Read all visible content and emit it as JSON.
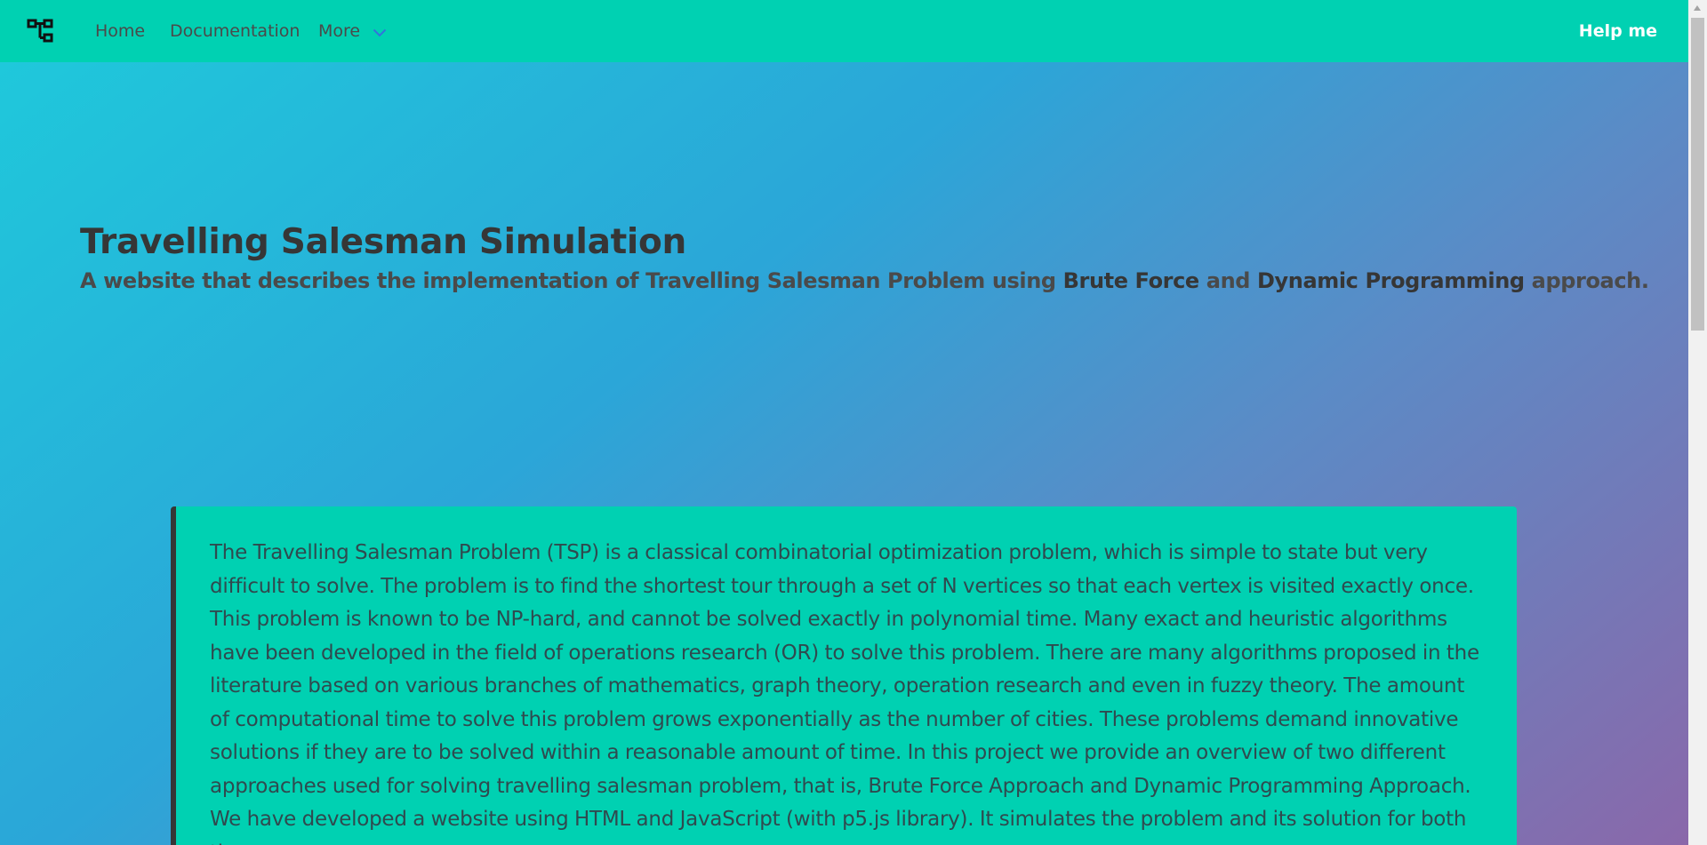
{
  "nav": {
    "logo_icon": "network-graph-icon",
    "home": "Home",
    "documentation": "Documentation",
    "more": "More",
    "more_icon": "chevron-down-icon",
    "help": "Help me"
  },
  "hero": {
    "title": "Travelling Salesman Simulation",
    "subtitle_pre": "A website that describes the implementation of Travelling Salesman Problem using ",
    "subtitle_bold1": "Brute Force",
    "subtitle_mid": " and ",
    "subtitle_bold2": "Dynamic Programming",
    "subtitle_post": " approach."
  },
  "intro": {
    "text": "The Travelling Salesman Problem (TSP) is a classical combinatorial optimization problem, which is simple to state but very difficult to solve. The problem is to find the shortest tour through a set of N vertices so that each vertex is visited exactly once. This problem is known to be NP-hard, and cannot be solved exactly in polynomial time. Many exact and heuristic algorithms have been developed in the field of operations research (OR) to solve this problem. There are many algorithms proposed in the literature based on various branches of mathematics, graph theory, operation research and even in fuzzy theory. The amount of computational time to solve this problem grows exponentially as the number of cities. These problems demand innovative solutions if they are to be solved within a reasonable amount of time. In this project we provide an overview of two different approaches used for solving travelling salesman problem, that is, Brute Force Approach and Dynamic Programming Approach. We have developed a website using HTML and JavaScript (with p5.js library). It simulates the problem and its solution for both the"
  },
  "colors": {
    "primary": "#00d1b2",
    "text_dark": "#363636",
    "text": "#4a4a4a"
  }
}
